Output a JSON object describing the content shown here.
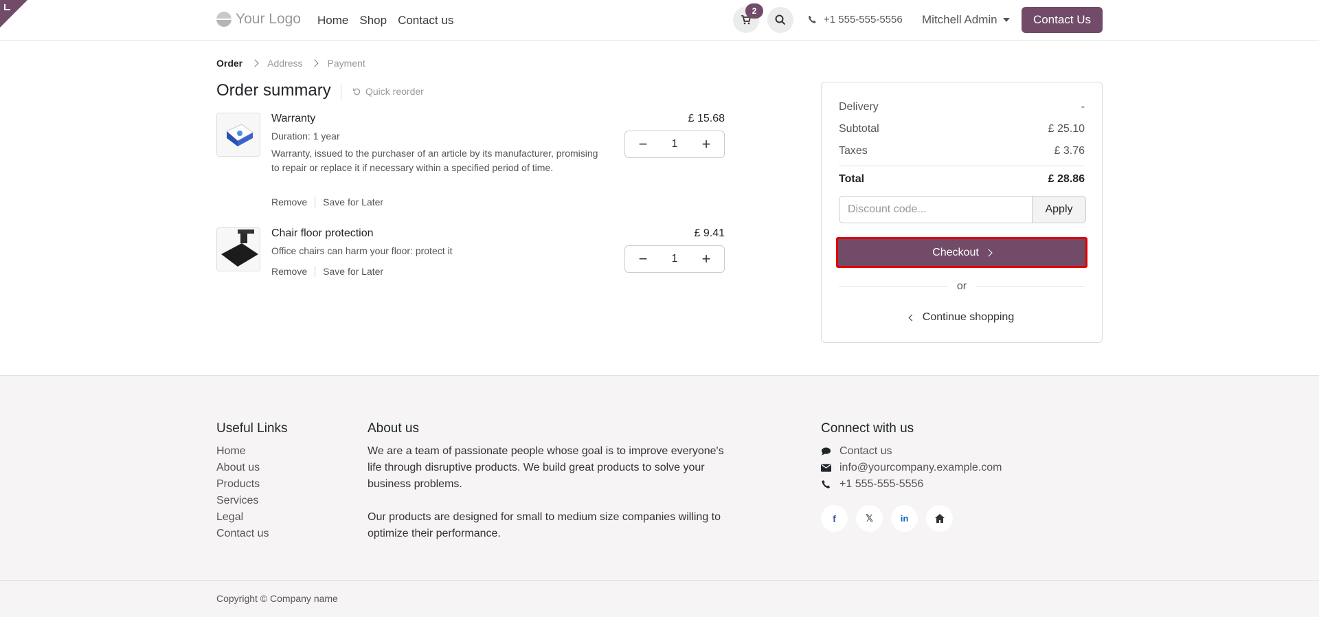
{
  "header": {
    "logo_text": "Your Logo",
    "nav": [
      "Home",
      "Shop",
      "Contact us"
    ],
    "cart_count": "2",
    "phone": "+1 555-555-5556",
    "user": "Mitchell Admin",
    "contact_button": "Contact Us"
  },
  "breadcrumb": [
    "Order",
    "Address",
    "Payment"
  ],
  "summary": {
    "title": "Order summary",
    "quick_reorder": "Quick reorder"
  },
  "items": [
    {
      "name": "Warranty",
      "sub1": "Duration: 1 year",
      "sub2": "Warranty, issued to the purchaser of an article by its manufacturer, promising to repair or replace it if necessary within a specified period of time.",
      "price": "£ 15.68",
      "qty": "1",
      "remove": "Remove",
      "save": "Save for Later"
    },
    {
      "name": "Chair floor protection",
      "sub1": "Office chairs can harm your floor: protect it",
      "price": "£ 9.41",
      "qty": "1",
      "remove": "Remove",
      "save": "Save for Later"
    }
  ],
  "card": {
    "delivery_label": "Delivery",
    "delivery_value": "-",
    "subtotal_label": "Subtotal",
    "subtotal_value": "£ 25.10",
    "taxes_label": "Taxes",
    "taxes_value": "£ 3.76",
    "total_label": "Total",
    "total_value": "£ 28.86",
    "discount_placeholder": "Discount code...",
    "apply": "Apply",
    "checkout": "Checkout",
    "or": "or",
    "continue": "Continue shopping"
  },
  "footer": {
    "useful_links_title": "Useful Links",
    "useful_links": [
      "Home",
      "About us",
      "Products",
      "Services",
      "Legal",
      "Contact us"
    ],
    "about_title": "About us",
    "about_p1": "We are a team of passionate people whose goal is to improve everyone's life through disruptive products. We build great products to solve your business problems.",
    "about_p2": "Our products are designed for small to medium size companies willing to optimize their performance.",
    "connect_title": "Connect with us",
    "connect_contact": "Contact us",
    "connect_email": "info@yourcompany.example.com",
    "connect_phone": "+1 555-555-5556",
    "copyright": "Copyright © Company name"
  },
  "colors": {
    "brand": "#714b67",
    "highlight": "#e00000"
  }
}
